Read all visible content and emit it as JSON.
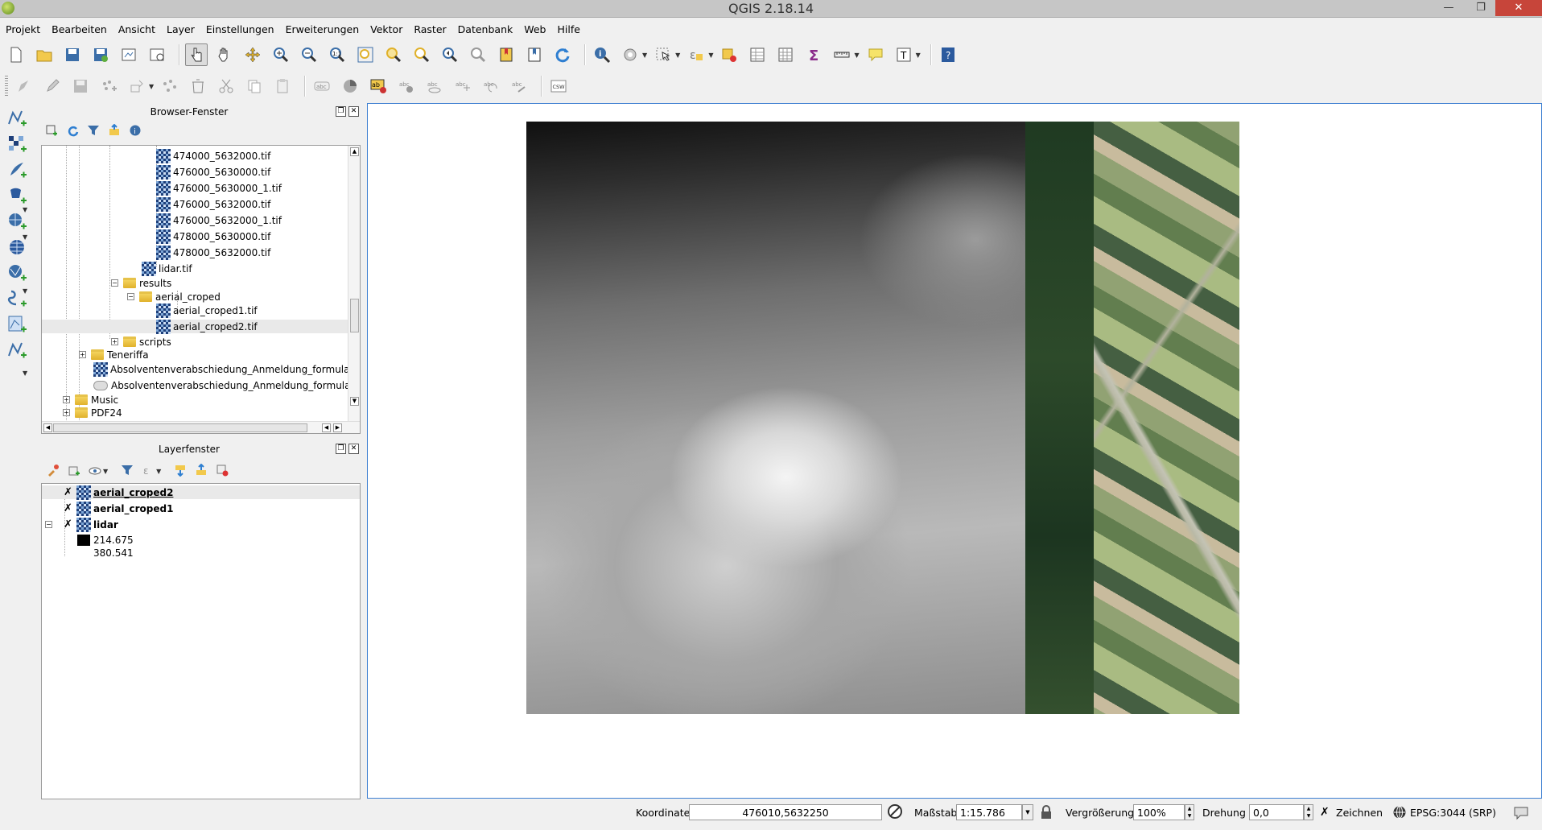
{
  "window": {
    "title": "QGIS 2.18.14"
  },
  "menu": [
    "Projekt",
    "Bearbeiten",
    "Ansicht",
    "Layer",
    "Einstellungen",
    "Erweiterungen",
    "Vektor",
    "Raster",
    "Datenbank",
    "Web",
    "Hilfe"
  ],
  "toolbar2": {
    "csw_label": "CSW"
  },
  "browser": {
    "title": "Browser-Fenster",
    "items": [
      {
        "label": "474000_5632000.tif",
        "type": "raster"
      },
      {
        "label": "476000_5630000.tif",
        "type": "raster"
      },
      {
        "label": "476000_5630000_1.tif",
        "type": "raster"
      },
      {
        "label": "476000_5632000.tif",
        "type": "raster"
      },
      {
        "label": "476000_5632000_1.tif",
        "type": "raster"
      },
      {
        "label": "478000_5630000.tif",
        "type": "raster"
      },
      {
        "label": "478000_5632000.tif",
        "type": "raster"
      },
      {
        "label": "lidar.tif",
        "type": "raster"
      },
      {
        "label": "results",
        "type": "folder"
      },
      {
        "label": "aerial_croped",
        "type": "folder"
      },
      {
        "label": "aerial_croped1.tif",
        "type": "raster"
      },
      {
        "label": "aerial_croped2.tif",
        "type": "raster"
      },
      {
        "label": "scripts",
        "type": "folder"
      },
      {
        "label": "Teneriffa",
        "type": "folder"
      },
      {
        "label": "Absolventenverabschiedung_Anmeldung_formular.pdf",
        "type": "raster"
      },
      {
        "label": "Absolventenverabschiedung_Anmeldung_formular.pdf",
        "type": "other"
      },
      {
        "label": "Music",
        "type": "folder"
      },
      {
        "label": "PDF24",
        "type": "folder"
      }
    ]
  },
  "layers": {
    "title": "Layerfenster",
    "items": [
      {
        "label": "aerial_croped2"
      },
      {
        "label": "aerial_croped1"
      },
      {
        "label": "lidar"
      }
    ],
    "legend": {
      "min": "214.675",
      "max": "380.541"
    }
  },
  "status": {
    "coord_label": "Koordinate",
    "coord_value": "476010,5632250",
    "scale_label": "Maßstab",
    "scale_value": "1:15.786",
    "magnifier_label": "Vergrößerung",
    "magnifier_value": "100%",
    "rotation_label": "Drehung",
    "rotation_value": "0,0",
    "render_label": "Zeichnen",
    "crs_label": "EPSG:3044 (SRP)"
  },
  "colors": {
    "accent": "#3d7fd1",
    "close": "#c7453a"
  }
}
